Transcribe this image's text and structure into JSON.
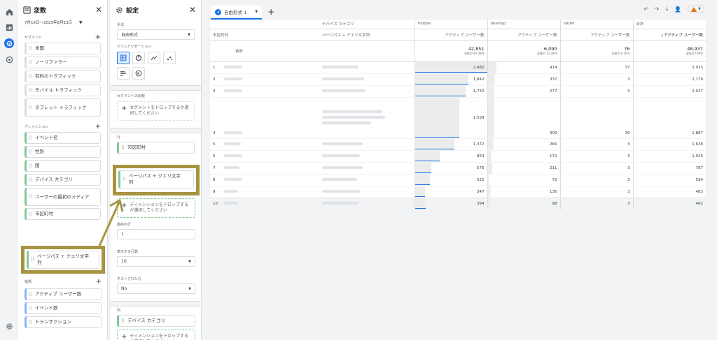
{
  "rail": {
    "icons": [
      "home-icon",
      "bar-chart-icon",
      "explore-icon",
      "advertising-icon",
      "settings-gear-icon"
    ]
  },
  "variables": {
    "title": "変数",
    "date_range": "7月16日〜2023年8月13日",
    "segments_label": "セグメント",
    "segments": [
      "米国",
      "ノーリファラー",
      "有料のトラフィック",
      "モバイル トラフィック",
      "タブレット トラフィック"
    ],
    "dimensions_label": "ディメンション",
    "dimensions": [
      "イベント名",
      "性別",
      "国",
      "デバイス カテゴリ",
      "ユーザーの最初のメディア",
      "市区町村",
      "ページパス + クエリ文字列"
    ],
    "metrics_label": "指標",
    "metrics": [
      "アクティブ ユーザー数",
      "イベント数",
      "トランザクション"
    ]
  },
  "settings": {
    "title": "設定",
    "technique_label": "手法",
    "technique_value": "自由形式",
    "visualization_label": "ビジュアリゼーション",
    "segment_compare_label": "セグメントの比較",
    "segment_drop": "セグメントをドロップするか選択してください",
    "rows_label": "行",
    "rows": [
      "市区町村",
      "ページパス + クエリ文字列"
    ],
    "dimension_drop": "ディメンションをドロップするか選択してください",
    "start_row_label": "最初の行",
    "start_row_value": "1",
    "show_rows_label": "表示する行数",
    "show_rows_value": "10",
    "nested_rows_label": "ネストされた行",
    "nested_rows_value": "No",
    "columns_label": "列",
    "columns": [
      "デバイス カテゴリ"
    ],
    "column_drop": "ディメンションをドロップするか選択してください"
  },
  "main": {
    "tab_label": "自由形式 1",
    "add_tab": "+",
    "table": {
      "dim_group_header": "デバイス カテゴリ",
      "row_header_1": "市区町村",
      "row_header_2": "ページパス + クエリ文字列",
      "columns": [
        "mobile",
        "desktop",
        "tablet",
        "合計"
      ],
      "metric_header": "アクティブ ユーザー数",
      "total_metric_header": "↓アクティブ ユーザー数",
      "total_label": "合計",
      "totals": [
        {
          "value": "42,851",
          "pct": "全体の 87.38%"
        },
        {
          "value": "6,090",
          "pct": "全体の 12.28%"
        },
        {
          "value": "76",
          "pct": "全体の 0.16%"
        },
        {
          "value": "48,937",
          "pct": "全体の 100%"
        }
      ],
      "rows": [
        {
          "n": "1",
          "mobile": "2,482",
          "mobile_frac": 1.0,
          "desktop": "414",
          "tablet": "37",
          "total": "2,933"
        },
        {
          "n": "2",
          "mobile": "1,842",
          "mobile_frac": 0.742,
          "desktop": "337",
          "tablet": "3",
          "total": "2,179"
        },
        {
          "n": "3",
          "mobile": "1,750",
          "mobile_frac": 0.705,
          "desktop": "277",
          "tablet": "3",
          "total": "2,027"
        },
        {
          "n": "4",
          "mobile": "1,539",
          "mobile_frac": 0.62,
          "desktop": "309",
          "tablet": "39",
          "total": "1,887"
        },
        {
          "n": "5",
          "mobile": "1,372",
          "mobile_frac": 0.553,
          "desktop": "266",
          "tablet": "3",
          "total": "1,638"
        },
        {
          "n": "6",
          "mobile": "853",
          "mobile_frac": 0.344,
          "desktop": "172",
          "tablet": "3",
          "total": "1,025"
        },
        {
          "n": "7",
          "mobile": "576",
          "mobile_frac": 0.232,
          "desktop": "211",
          "tablet": "3",
          "total": "787"
        },
        {
          "n": "8",
          "mobile": "522",
          "mobile_frac": 0.21,
          "desktop": "72",
          "tablet": "3",
          "total": "594"
        },
        {
          "n": "9",
          "mobile": "347",
          "mobile_frac": 0.14,
          "desktop": "136",
          "tablet": "3",
          "total": "483"
        },
        {
          "n": "10",
          "mobile": "364",
          "mobile_frac": 0.147,
          "desktop": "98",
          "tablet": "3",
          "total": "462"
        }
      ]
    }
  },
  "colors": {
    "accent": "#1a73e8",
    "highlight": "#a89440",
    "dimension": "#81c995",
    "metric": "#8ab4f8"
  }
}
